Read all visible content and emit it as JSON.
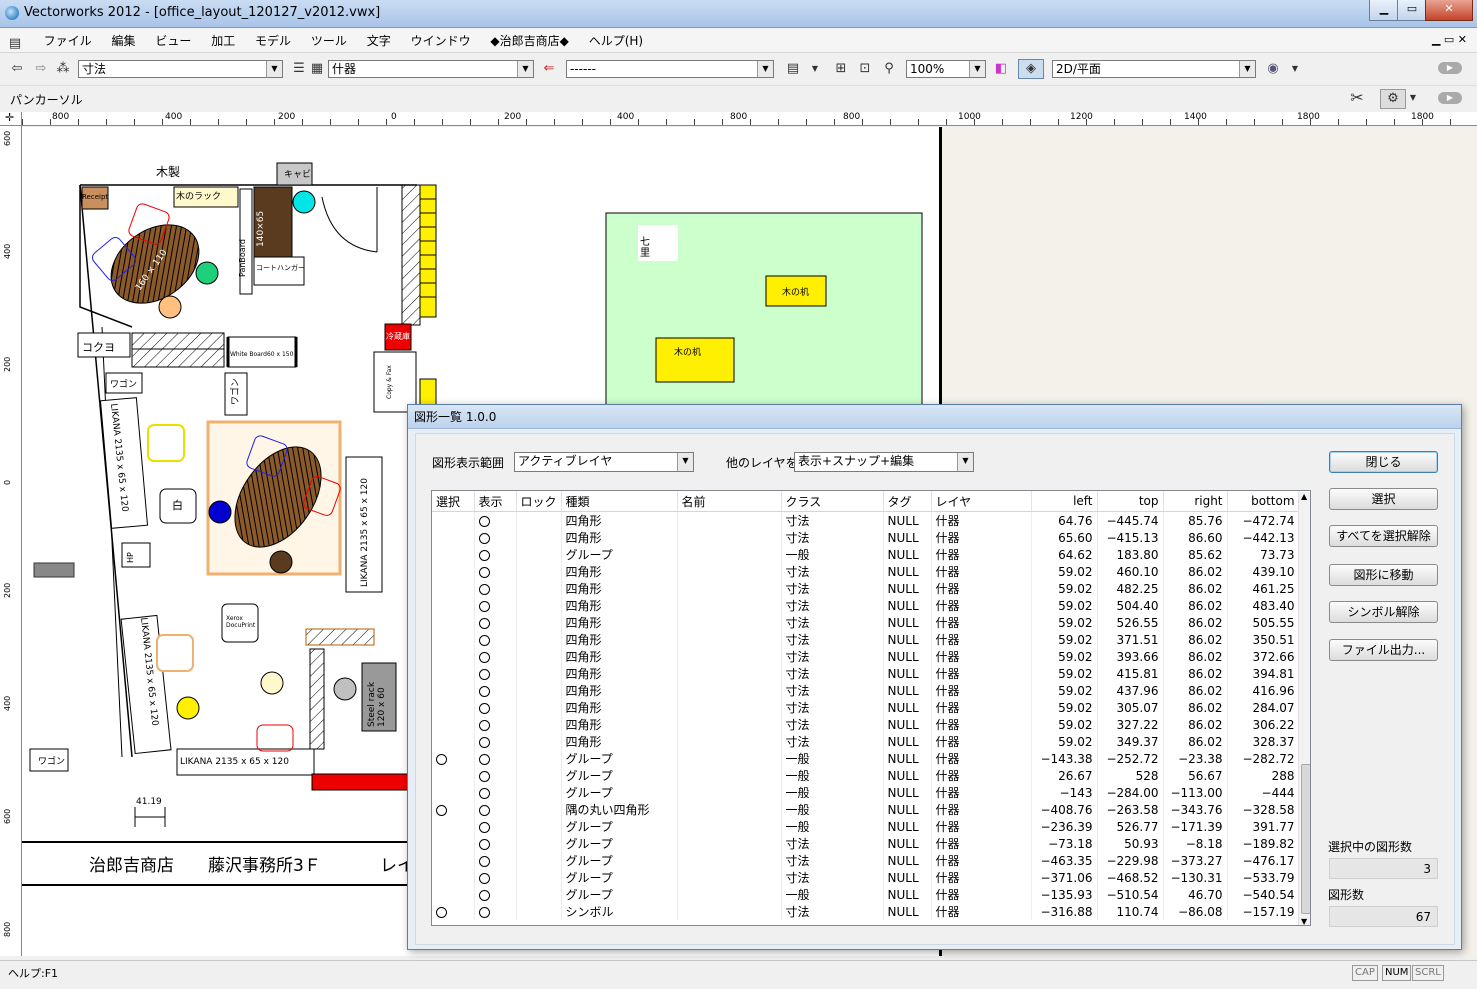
{
  "window": {
    "title": "Vectorworks 2012 - [office_layout_120127_v2012.vwx]"
  },
  "menu": [
    "ファイル",
    "編集",
    "ビュー",
    "加工",
    "モデル",
    "ツール",
    "文字",
    "ウインドウ",
    "◆治郎吉商店◆",
    "ヘルプ(H)"
  ],
  "toolbar": {
    "class_combo": "寸法",
    "layer_combo": "什器",
    "style_combo": "------",
    "zoom": "100%",
    "view": "2D/平面"
  },
  "palette": {
    "label": "パンカーソル"
  },
  "ruler": {
    "h_labels": [
      "800",
      "400",
      "200",
      "0",
      "200",
      "400",
      "800",
      "800",
      "1000",
      "1200",
      "1400",
      "1800",
      "1800"
    ],
    "v_labels": [
      "600",
      "400",
      "200",
      "0",
      "200",
      "400",
      "600",
      "800"
    ]
  },
  "drawing": {
    "labels": {
      "mokusei": "木製",
      "kyabi": "キャビ",
      "receipt": "Receipt",
      "rack": "木のラック",
      "size_140x65": "140×65",
      "size_160x110": "160 × 110",
      "panboard": "PanBoard",
      "coathanger": "コートハンガー",
      "kokuyo": "コクヨ",
      "whiteboard": "White Board60 x 150",
      "reizouko": "冷蔵庫",
      "wagon1": "ワゴン",
      "wagon2": "ワゴン",
      "wagon3": "ワゴン",
      "copyfax": "Copy & Fax",
      "likana1": "LIKANA 2135 x 65 x 120",
      "likana2": "LIKANA 2135 x 65 x 120",
      "likana3": "LIKANA 2135 x 65 x 120",
      "likana4": "LIKANA 2135 x 65 x 120",
      "shiro": "白",
      "hp": "HP",
      "xerox": "Xerox DocuPrint",
      "steelrack": "Steel rack 120 x 60",
      "dim": "41.19",
      "shichiri": "七里",
      "desk1": "木の机",
      "desk2": "木の机",
      "footer1": "治郎吉商店",
      "footer2": "藤沢事務所3Ｆ",
      "footer3": "レイ"
    }
  },
  "status": {
    "help": "ヘルプ:F1",
    "cap": "CAP",
    "num": "NUM",
    "scrl": "SCRL"
  },
  "dialog": {
    "title": "図形一覧 1.0.0",
    "scope_label": "図形表示範囲",
    "scope_value": "アクティブレイヤ",
    "other_label": "他のレイヤを",
    "other_value": "表示+スナップ+編集",
    "buttons": {
      "close": "閉じる",
      "select": "選択",
      "deselect_all": "すべてを選択解除",
      "move_to": "図形に移動",
      "unsymbol": "シンボル解除",
      "export": "ファイル出力..."
    },
    "selected_count_label": "選択中の図形数",
    "selected_count": "3",
    "total_count_label": "図形数",
    "total_count": "67",
    "columns": [
      "選択",
      "表示",
      "ロック",
      "種類",
      "名前",
      "クラス",
      "タグ",
      "レイヤ",
      "left",
      "top",
      "right",
      "bottom"
    ],
    "rows": [
      {
        "sel": false,
        "type": "四角形",
        "cls": "寸法",
        "tag": "NULL",
        "layer": "什器",
        "left": "64.76",
        "top": "−445.74",
        "right": "85.76",
        "bottom": "−472.74"
      },
      {
        "sel": false,
        "type": "四角形",
        "cls": "寸法",
        "tag": "NULL",
        "layer": "什器",
        "left": "65.60",
        "top": "−415.13",
        "right": "86.60",
        "bottom": "−442.13"
      },
      {
        "sel": false,
        "type": "グループ",
        "cls": "一般",
        "tag": "NULL",
        "layer": "什器",
        "left": "64.62",
        "top": "183.80",
        "right": "85.62",
        "bottom": "73.73"
      },
      {
        "sel": false,
        "type": "四角形",
        "cls": "寸法",
        "tag": "NULL",
        "layer": "什器",
        "left": "59.02",
        "top": "460.10",
        "right": "86.02",
        "bottom": "439.10"
      },
      {
        "sel": false,
        "type": "四角形",
        "cls": "寸法",
        "tag": "NULL",
        "layer": "什器",
        "left": "59.02",
        "top": "482.25",
        "right": "86.02",
        "bottom": "461.25"
      },
      {
        "sel": false,
        "type": "四角形",
        "cls": "寸法",
        "tag": "NULL",
        "layer": "什器",
        "left": "59.02",
        "top": "504.40",
        "right": "86.02",
        "bottom": "483.40"
      },
      {
        "sel": false,
        "type": "四角形",
        "cls": "寸法",
        "tag": "NULL",
        "layer": "什器",
        "left": "59.02",
        "top": "526.55",
        "right": "86.02",
        "bottom": "505.55"
      },
      {
        "sel": false,
        "type": "四角形",
        "cls": "寸法",
        "tag": "NULL",
        "layer": "什器",
        "left": "59.02",
        "top": "371.51",
        "right": "86.02",
        "bottom": "350.51"
      },
      {
        "sel": false,
        "type": "四角形",
        "cls": "寸法",
        "tag": "NULL",
        "layer": "什器",
        "left": "59.02",
        "top": "393.66",
        "right": "86.02",
        "bottom": "372.66"
      },
      {
        "sel": false,
        "type": "四角形",
        "cls": "寸法",
        "tag": "NULL",
        "layer": "什器",
        "left": "59.02",
        "top": "415.81",
        "right": "86.02",
        "bottom": "394.81"
      },
      {
        "sel": false,
        "type": "四角形",
        "cls": "寸法",
        "tag": "NULL",
        "layer": "什器",
        "left": "59.02",
        "top": "437.96",
        "right": "86.02",
        "bottom": "416.96"
      },
      {
        "sel": false,
        "type": "四角形",
        "cls": "寸法",
        "tag": "NULL",
        "layer": "什器",
        "left": "59.02",
        "top": "305.07",
        "right": "86.02",
        "bottom": "284.07"
      },
      {
        "sel": false,
        "type": "四角形",
        "cls": "寸法",
        "tag": "NULL",
        "layer": "什器",
        "left": "59.02",
        "top": "327.22",
        "right": "86.02",
        "bottom": "306.22"
      },
      {
        "sel": false,
        "type": "四角形",
        "cls": "寸法",
        "tag": "NULL",
        "layer": "什器",
        "left": "59.02",
        "top": "349.37",
        "right": "86.02",
        "bottom": "328.37"
      },
      {
        "sel": true,
        "type": "グループ",
        "cls": "一般",
        "tag": "NULL",
        "layer": "什器",
        "left": "−143.38",
        "top": "−252.72",
        "right": "−23.38",
        "bottom": "−282.72"
      },
      {
        "sel": false,
        "type": "グループ",
        "cls": "一般",
        "tag": "NULL",
        "layer": "什器",
        "left": "26.67",
        "top": "528",
        "right": "56.67",
        "bottom": "288"
      },
      {
        "sel": false,
        "type": "グループ",
        "cls": "一般",
        "tag": "NULL",
        "layer": "什器",
        "left": "−143",
        "top": "−284.00",
        "right": "−113.00",
        "bottom": "−444"
      },
      {
        "sel": true,
        "type": "隅の丸い四角形",
        "cls": "一般",
        "tag": "NULL",
        "layer": "什器",
        "left": "−408.76",
        "top": "−263.58",
        "right": "−343.76",
        "bottom": "−328.58"
      },
      {
        "sel": false,
        "type": "グループ",
        "cls": "一般",
        "tag": "NULL",
        "layer": "什器",
        "left": "−236.39",
        "top": "526.77",
        "right": "−171.39",
        "bottom": "391.77"
      },
      {
        "sel": false,
        "type": "グループ",
        "cls": "寸法",
        "tag": "NULL",
        "layer": "什器",
        "left": "−73.18",
        "top": "50.93",
        "right": "−8.18",
        "bottom": "−189.82"
      },
      {
        "sel": false,
        "type": "グループ",
        "cls": "寸法",
        "tag": "NULL",
        "layer": "什器",
        "left": "−463.35",
        "top": "−229.98",
        "right": "−373.27",
        "bottom": "−476.17"
      },
      {
        "sel": false,
        "type": "グループ",
        "cls": "寸法",
        "tag": "NULL",
        "layer": "什器",
        "left": "−371.06",
        "top": "−468.52",
        "right": "−130.31",
        "bottom": "−533.79"
      },
      {
        "sel": false,
        "type": "グループ",
        "cls": "一般",
        "tag": "NULL",
        "layer": "什器",
        "left": "−135.93",
        "top": "−510.54",
        "right": "46.70",
        "bottom": "−540.54"
      },
      {
        "sel": true,
        "type": "シンボル",
        "cls": "寸法",
        "tag": "NULL",
        "layer": "什器",
        "left": "−316.88",
        "top": "110.74",
        "right": "−86.08",
        "bottom": "−157.19"
      }
    ]
  }
}
